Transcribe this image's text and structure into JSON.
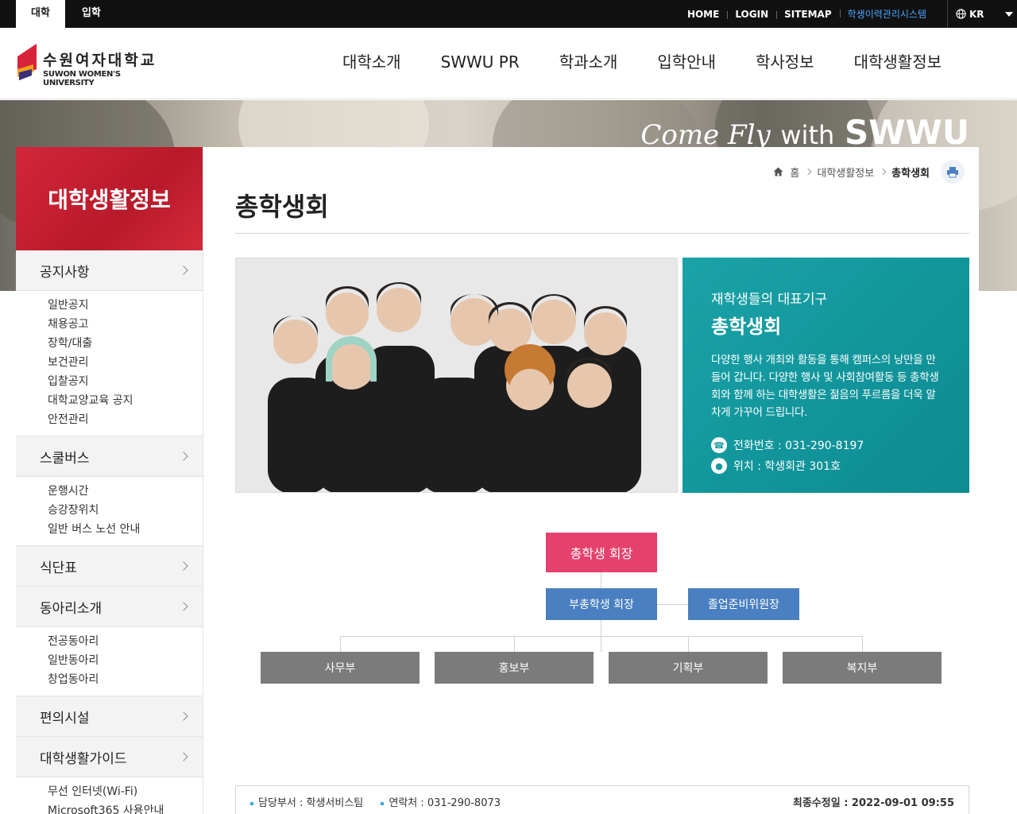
{
  "topbar": {
    "tabs": [
      {
        "label": "대학"
      },
      {
        "label": "입학"
      }
    ],
    "links": [
      "HOME",
      "LOGIN",
      "SITEMAP"
    ],
    "highlight_link": "학생이력관리시스템",
    "lang": "KR"
  },
  "header": {
    "logo_kr": "수원여자대학교",
    "logo_en": "SUWON WOMEN'S UNIVERSITY",
    "gnb": [
      "대학소개",
      "SWWU PR",
      "학과소개",
      "입학안내",
      "학사정보",
      "대학생활정보"
    ]
  },
  "visual": {
    "tag_script": "Come Fly",
    "tag_with": "with",
    "tag_brand": "SWWU"
  },
  "lnb": {
    "title": "대학생활정보",
    "groups": [
      {
        "title": "공지사항",
        "items": [
          "일반공지",
          "채용공고",
          "장학/대출",
          "보건관리",
          "입찰공지",
          "대학교양교육 공지",
          "안전관리"
        ]
      },
      {
        "title": "스쿨버스",
        "items": [
          "운행시간",
          "승강장위치",
          "일반 버스 노선 안내"
        ]
      },
      {
        "title": "식단표",
        "items": []
      },
      {
        "title": "동아리소개",
        "items": [
          "전공동아리",
          "일반동아리",
          "창업동아리"
        ]
      },
      {
        "title": "편의시설",
        "items": []
      },
      {
        "title": "대학생활가이드",
        "items": [
          "무선 인터넷(Wi-Fi)",
          "Microsoft365 사용안내"
        ]
      }
    ]
  },
  "content": {
    "breadcrumb": {
      "home": "홈",
      "parent": "대학생활정보",
      "current": "총학생회"
    },
    "page_title": "총학생회",
    "info": {
      "sub": "재학생들의 대표기구",
      "name": "총학생회",
      "desc": "다양한 행사 개최와 활동을 통해 캠퍼스의 낭만을 만들어 갑니다. 다양한 행사 및 사회참여활동 등 총학생회와 함께 하는 대학생활은 젊음의 푸르름을 더욱 알차게 가꾸어 드립니다.",
      "phone": "전화번호 : 031-290-8197",
      "location": "위치 : 학생회관 301호"
    },
    "org": {
      "president": "총학생 회장",
      "vice": "부총학생 회장",
      "grad": "졸업준비위원장",
      "depts": [
        "사무부",
        "홍보부",
        "기획부",
        "복지부"
      ]
    },
    "footer": {
      "dept": "담당부서 : 학생서비스팀",
      "contact": "연락처 : 031-290-8073",
      "updated": "최종수정일 : 2022-09-01 09:55"
    }
  },
  "colors": {
    "accent_red": "#c8202f",
    "teal": "#149aa0",
    "pink": "#e5416d",
    "blue": "#4a7fc1",
    "gray": "#7b7b7b"
  }
}
